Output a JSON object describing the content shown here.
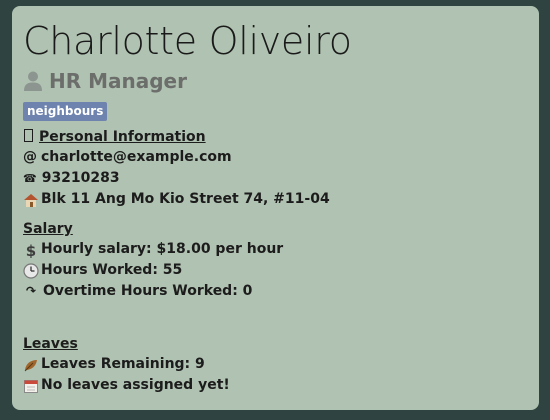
{
  "person": {
    "name": "Charlotte Oliveiro",
    "role": "HR Manager",
    "tag": "neighbours"
  },
  "personal_info": {
    "title": "Personal Information",
    "email_icon": "@",
    "email": "charlotte@example.com",
    "phone_icon": "☎",
    "phone": "93210283",
    "address": "Blk 11 Ang Mo Kio Street 74, #11-04"
  },
  "salary": {
    "title": "Salary",
    "hourly_label": "Hourly salary: $18.00 per hour",
    "hours_worked_label": "Hours Worked: 55",
    "overtime_icon": "↷",
    "overtime_label": "Overtime Hours Worked: 0"
  },
  "leaves": {
    "title": "Leaves",
    "remaining_label": "Leaves Remaining: 9",
    "assigned_label": "No leaves assigned yet!"
  },
  "icons": {
    "role": "person-icon",
    "personal_info": "info-box-icon",
    "email": "at-sign-icon",
    "phone": "phone-icon",
    "address": "house-icon",
    "hourly": "dollar-icon",
    "hours_worked": "clock-icon",
    "overtime": "arrow-icon",
    "leaves_remaining": "leaf-icon",
    "leaves_assigned": "calendar-icon"
  },
  "colors": {
    "background": "#2f4440",
    "card": "#b0c2b1",
    "tag": "#6e83ad",
    "role_text": "#6b6e6b"
  }
}
